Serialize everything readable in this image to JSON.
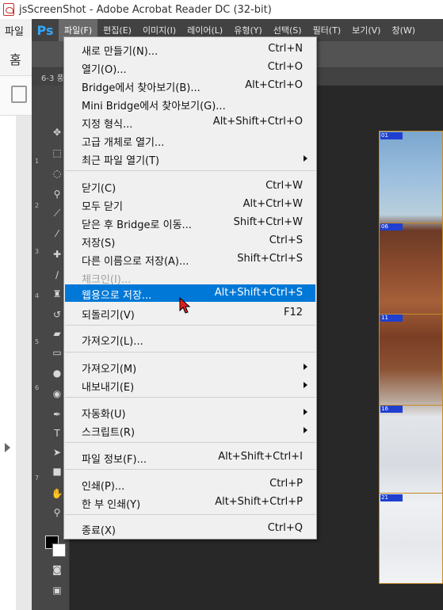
{
  "acrobat": {
    "title": "jsScreenShot - Adobe Acrobat Reader DC (32-bit)",
    "menu_first": "파일",
    "home_label": "홈"
  },
  "photoshop": {
    "logo": "Ps",
    "menus": [
      "파일(F)",
      "편집(E)",
      "이미지(I)",
      "레이어(L)",
      "유형(Y)",
      "선택(S)",
      "필터(T)",
      "보기(V)",
      "창(W)"
    ],
    "active_menu": "파일(F)",
    "doc_tab": "6-3 풍",
    "tool_numbers": [
      "1",
      "2",
      "3",
      "4",
      "5",
      "6",
      "7"
    ],
    "slices": [
      "01",
      "06",
      "11",
      "16",
      "21"
    ]
  },
  "file_menu": {
    "items": [
      {
        "label": "새로 만들기(N)...",
        "shortcut": "Ctrl+N"
      },
      {
        "label": "열기(O)...",
        "shortcut": "Ctrl+O"
      },
      {
        "label": "Bridge에서 찾아보기(B)...",
        "shortcut": "Alt+Ctrl+O"
      },
      {
        "label": "Mini Bridge에서 찾아보기(G)...",
        "shortcut": ""
      },
      {
        "label": "지정 형식...",
        "shortcut": "Alt+Shift+Ctrl+O"
      },
      {
        "label": "고급 개체로 열기...",
        "shortcut": ""
      },
      {
        "label": "최근 파일 열기(T)",
        "shortcut": ""
      },
      {
        "label": "닫기(C)",
        "shortcut": "Ctrl+W"
      },
      {
        "label": "모두 닫기",
        "shortcut": "Alt+Ctrl+W"
      },
      {
        "label": "닫은 후 Bridge로 이동...",
        "shortcut": "Shift+Ctrl+W"
      },
      {
        "label": "저장(S)",
        "shortcut": "Ctrl+S"
      },
      {
        "label": "다른 이름으로 저장(A)...",
        "shortcut": "Shift+Ctrl+S"
      },
      {
        "label": "체크인(I)...",
        "shortcut": ""
      },
      {
        "label": "웹용으로 저장...",
        "shortcut": "Alt+Shift+Ctrl+S"
      },
      {
        "label": "되돌리기(V)",
        "shortcut": "F12"
      },
      {
        "label": "가져오기(L)...",
        "shortcut": ""
      },
      {
        "label": "가져오기(M)",
        "shortcut": ""
      },
      {
        "label": "내보내기(E)",
        "shortcut": ""
      },
      {
        "label": "자동화(U)",
        "shortcut": ""
      },
      {
        "label": "스크립트(R)",
        "shortcut": ""
      },
      {
        "label": "파일 정보(F)...",
        "shortcut": "Alt+Shift+Ctrl+I"
      },
      {
        "label": "인쇄(P)...",
        "shortcut": "Ctrl+P"
      },
      {
        "label": "한 부 인쇄(Y)",
        "shortcut": "Alt+Shift+Ctrl+P"
      },
      {
        "label": "종료(X)",
        "shortcut": "Ctrl+Q"
      }
    ],
    "highlight_color": "#0078d7"
  }
}
